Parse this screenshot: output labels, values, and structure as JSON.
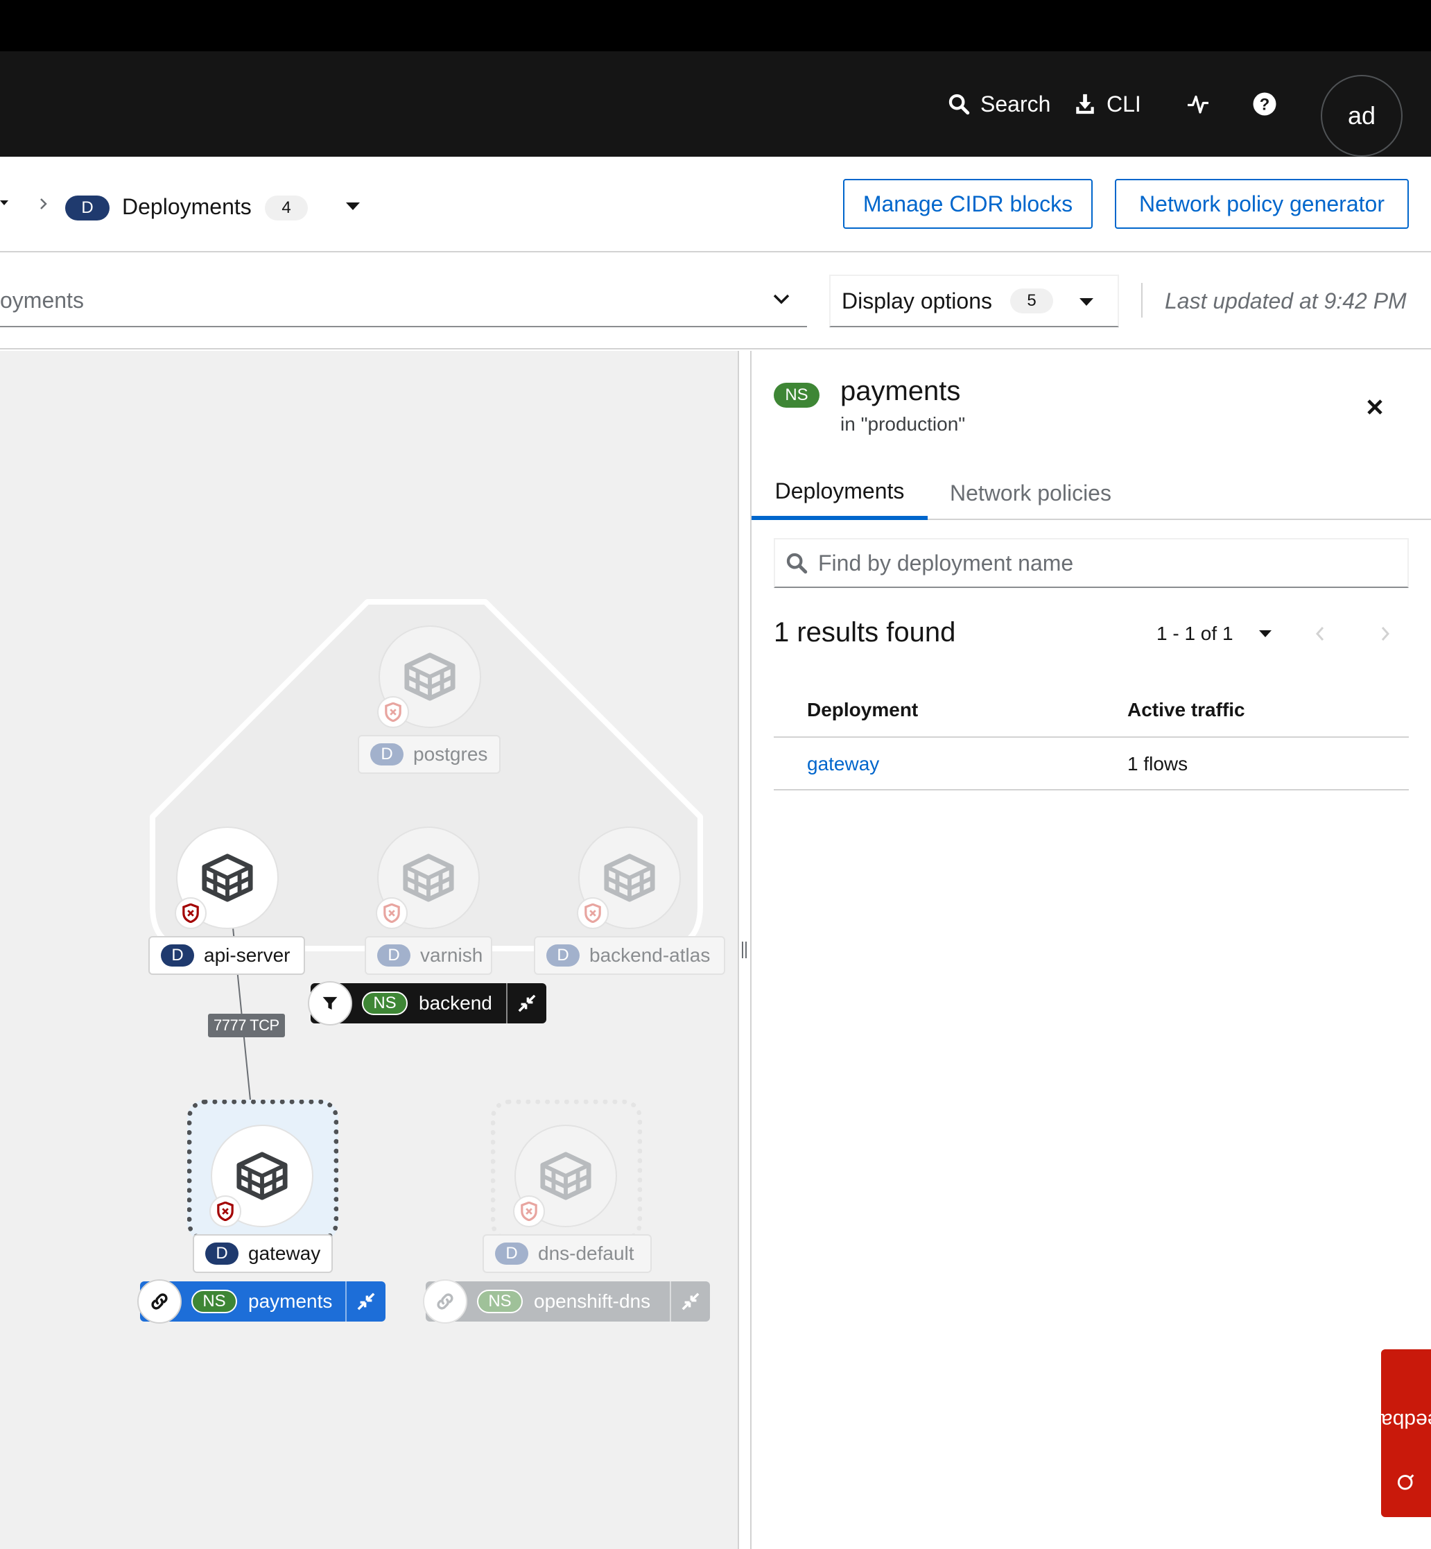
{
  "masthead": {
    "search_label": "Search",
    "cli_label": "CLI",
    "avatar_initials": "ad"
  },
  "breadcrumb": {
    "badge": "D",
    "label": "Deployments",
    "count": "4"
  },
  "buttons": {
    "manage_cidr": "Manage CIDR blocks",
    "policy_generator": "Network policy generator"
  },
  "filter": {
    "partial_text": "oyments",
    "display_options_label": "Display options",
    "display_options_count": "5",
    "last_updated": "Last updated at 9:42 PM"
  },
  "graph": {
    "edge_label": "7777 TCP",
    "nodes": {
      "postgres": "postgres",
      "api_server": "api-server",
      "varnish": "varnish",
      "backend_atlas": "backend-atlas",
      "gateway": "gateway",
      "dns_default": "dns-default"
    },
    "deploy_badge": "D",
    "ns_badge": "NS",
    "namespaces": {
      "backend": "backend",
      "payments": "payments",
      "openshift_dns": "openshift-dns"
    }
  },
  "panel": {
    "badge": "NS",
    "title": "payments",
    "subtitle": "in \"production\"",
    "tabs": [
      "Deployments",
      "Network policies"
    ],
    "search_placeholder": "Find by deployment name",
    "results": "1 results found",
    "pagination": "1 - 1 of 1",
    "columns": [
      "Deployment",
      "Active traffic"
    ],
    "rows": [
      {
        "deployment": "gateway",
        "traffic": "1 flows"
      }
    ]
  },
  "feedback_label": "Feedback",
  "colors": {
    "masthead": "#151515",
    "link_blue": "#0066cc",
    "deploy_badge": "#1f3a6e",
    "ns_green": "#3e8635",
    "ns_bar_dark": "#151515",
    "ns_bar_selected": "#1d6ed8",
    "feedback_red": "#c9190b"
  }
}
